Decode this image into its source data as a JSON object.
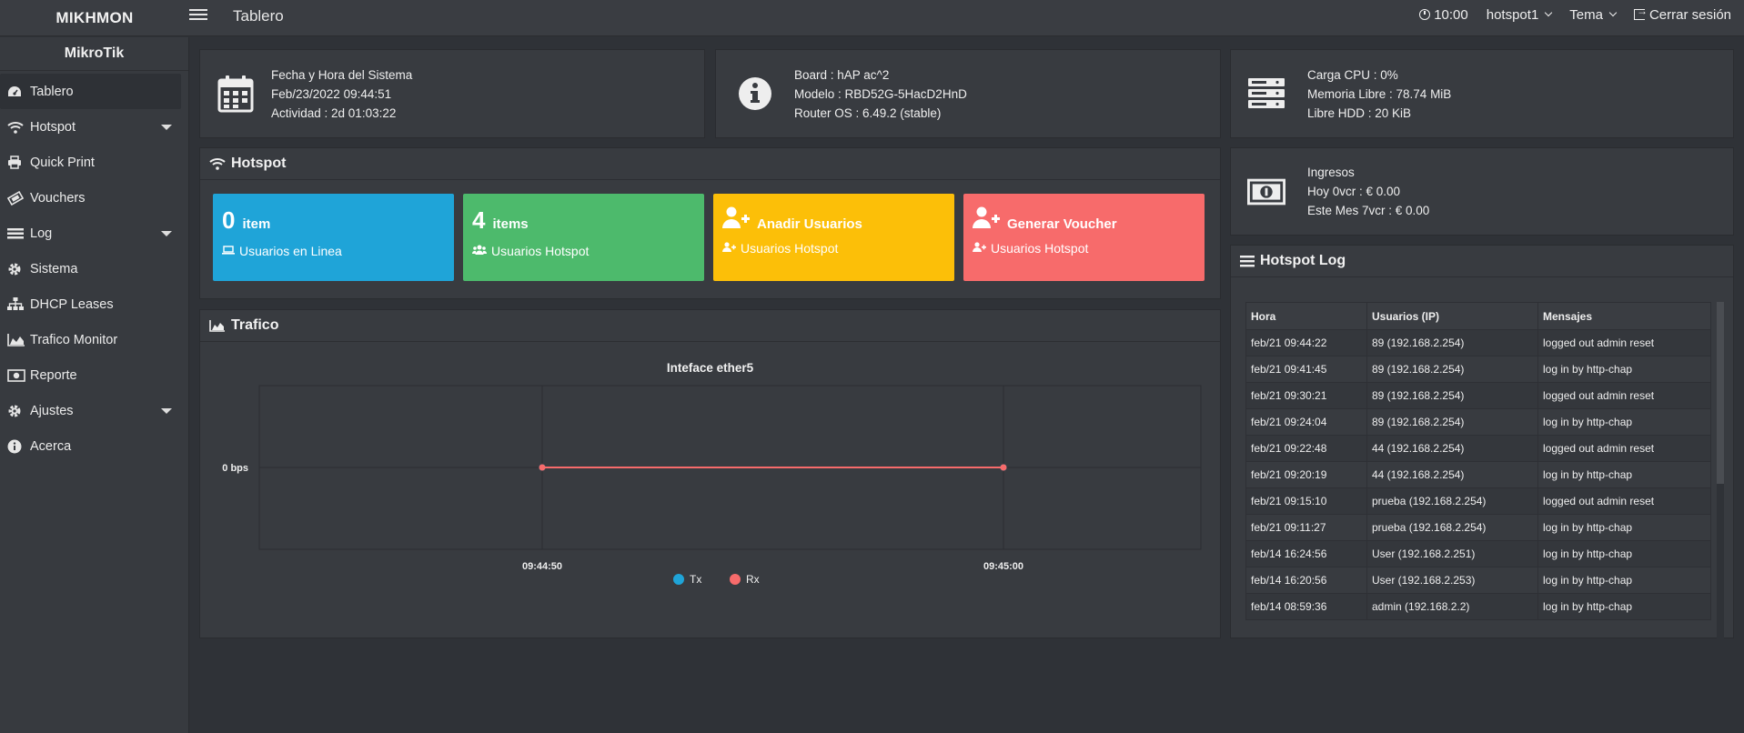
{
  "topbar": {
    "brand": "MIKHMON",
    "page_title": "Tablero",
    "time": "10:00",
    "session": "hotspot1",
    "theme": "Tema",
    "logout": "Cerrar sesión"
  },
  "sidebar": {
    "header": "MikroTik",
    "items": [
      {
        "label": "Tablero",
        "icon": "dashboard-icon"
      },
      {
        "label": "Hotspot",
        "icon": "wifi-icon"
      },
      {
        "label": "Quick Print",
        "icon": "printer-icon"
      },
      {
        "label": "Vouchers",
        "icon": "ticket-icon"
      },
      {
        "label": "Log",
        "icon": "list-icon"
      },
      {
        "label": "Sistema",
        "icon": "gear-icon"
      },
      {
        "label": "DHCP Leases",
        "icon": "sitemap-icon"
      },
      {
        "label": "Trafico Monitor",
        "icon": "area-chart-icon"
      },
      {
        "label": "Reporte",
        "icon": "money-icon"
      },
      {
        "label": "Ajustes",
        "icon": "gear-icon"
      },
      {
        "label": "Acerca",
        "icon": "info-icon"
      }
    ]
  },
  "system_box": {
    "line1": "Fecha y Hora del Sistema",
    "line2": "Feb/23/2022 09:44:51",
    "line3": "Actividad : 2d 01:03:22"
  },
  "board_box": {
    "line1": "Board : hAP ac^2",
    "line2": "Modelo : RBD52G-5HacD2HnD",
    "line3": "Router OS : 6.49.2 (stable)"
  },
  "resource_box": {
    "line1": "Carga CPU : 0%",
    "line2": "Memoria Libre : 78.74 MiB",
    "line3": "Libre HDD : 20 KiB"
  },
  "income_box": {
    "line1": "Ingresos",
    "line2": "Hoy 0vcr : € 0.00",
    "line3": "Este Mes 7vcr : € 0.00"
  },
  "hotspot": {
    "title": "Hotspot",
    "tiles": [
      {
        "num": "0",
        "label": "item",
        "sub": "Usuarios en Linea",
        "color": "#1fa4d8"
      },
      {
        "num": "4",
        "label": "items",
        "sub": "Usuarios Hotspot",
        "color": "#4dba6c"
      },
      {
        "num": "",
        "label": "Anadir Usuarios",
        "sub": "Usuarios Hotspot",
        "color": "#fcbf08"
      },
      {
        "num": "",
        "label": "Generar Voucher",
        "sub": "Usuarios Hotspot",
        "color": "#f76b6b"
      }
    ]
  },
  "traffic": {
    "title": "Trafico"
  },
  "chart_data": {
    "type": "line",
    "title": "Inteface ether5",
    "x": [
      "09:44:50",
      "09:45:00"
    ],
    "ytick": "0 bps",
    "series": [
      {
        "name": "Tx",
        "color": "#1fa4d8",
        "values": [
          0,
          0
        ]
      },
      {
        "name": "Rx",
        "color": "#f76b6b",
        "values": [
          0,
          0
        ]
      }
    ],
    "legend": "bottom-center",
    "grid": true
  },
  "hotspot_log": {
    "title": "Hotspot Log",
    "columns": [
      "Hora",
      "Usuarios (IP)",
      "Mensajes"
    ],
    "rows": [
      [
        "feb/21 09:44:22",
        "89 (192.168.2.254)",
        "logged out admin reset"
      ],
      [
        "feb/21 09:41:45",
        "89 (192.168.2.254)",
        "log in by http-chap"
      ],
      [
        "feb/21 09:30:21",
        "89 (192.168.2.254)",
        "logged out admin reset"
      ],
      [
        "feb/21 09:24:04",
        "89 (192.168.2.254)",
        "log in by http-chap"
      ],
      [
        "feb/21 09:22:48",
        "44 (192.168.2.254)",
        "logged out admin reset"
      ],
      [
        "feb/21 09:20:19",
        "44 (192.168.2.254)",
        "log in by http-chap"
      ],
      [
        "feb/21 09:15:10",
        "prueba (192.168.2.254)",
        "logged out admin reset"
      ],
      [
        "feb/21 09:11:27",
        "prueba (192.168.2.254)",
        "log in by http-chap"
      ],
      [
        "feb/14 16:24:56",
        "User (192.168.2.251)",
        "log in by http-chap"
      ],
      [
        "feb/14 16:20:56",
        "User (192.168.2.253)",
        "log in by http-chap"
      ],
      [
        "feb/14 08:59:36",
        "admin (192.168.2.2)",
        "log in by http-chap"
      ]
    ]
  }
}
